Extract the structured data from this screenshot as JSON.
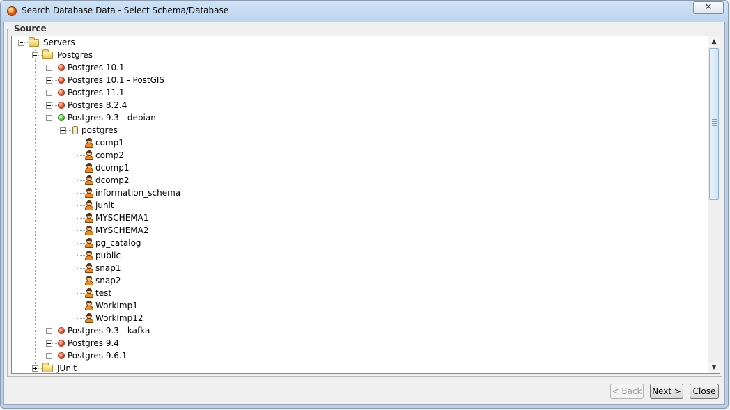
{
  "window": {
    "title": "Search Database Data - Select Schema/Database",
    "close_glyph": "✕"
  },
  "source": {
    "label": "Source"
  },
  "tree": {
    "root": {
      "label": "Servers",
      "expanded": true,
      "icon": "folder-open-icon"
    },
    "group": {
      "label": "Postgres",
      "expanded": true,
      "icon": "folder-open-icon"
    },
    "servers": [
      {
        "label": "Postgres 10.1",
        "status": "red",
        "expanded": false
      },
      {
        "label": "Postgres 10.1 - PostGIS",
        "status": "red",
        "expanded": false
      },
      {
        "label": "Postgres 11.1",
        "status": "red",
        "expanded": false
      },
      {
        "label": "Postgres 8.2.4",
        "status": "red",
        "expanded": false
      },
      {
        "label": "Postgres 9.3 - debian",
        "status": "green",
        "expanded": true
      }
    ],
    "database": {
      "label": "postgres",
      "expanded": true,
      "icon": "database-icon"
    },
    "schemas": [
      "comp1",
      "comp2",
      "dcomp1",
      "dcomp2",
      "information_schema",
      "junit",
      "MYSCHEMA1",
      "MYSCHEMA2",
      "pg_catalog",
      "public",
      "snap1",
      "snap2",
      "test",
      "WorkImp1",
      "WorkImp12"
    ],
    "servers_after": [
      {
        "label": "Postgres 9.3 - kafka",
        "status": "red",
        "expanded": false
      },
      {
        "label": "Postgres 9.4",
        "status": "red",
        "expanded": false
      },
      {
        "label": "Postgres 9.6.1",
        "status": "red",
        "expanded": false
      }
    ],
    "other_group": {
      "label": "JUnit",
      "expanded": false,
      "icon": "folder-icon"
    }
  },
  "scrollbar": {
    "up_glyph": "▲",
    "down_glyph": "▼",
    "position_fraction": 0.0
  },
  "buttons": {
    "back": {
      "label": "< Back",
      "enabled": false
    },
    "next": {
      "label": "Next >",
      "enabled": true
    },
    "close": {
      "label": "Close",
      "enabled": true
    }
  },
  "colors": {
    "status_red": "#f0552a",
    "status_green": "#4fcb2f",
    "selection": "#3399ff"
  }
}
